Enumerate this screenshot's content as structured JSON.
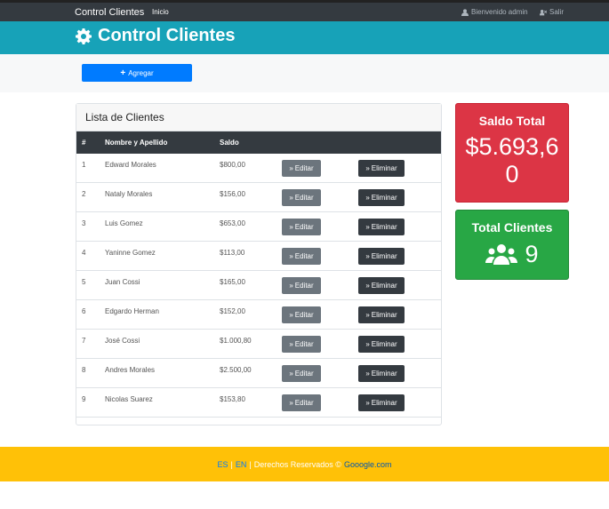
{
  "navbar": {
    "brand": "Control Clientes",
    "home": "Inicio",
    "welcome": "Bienvenido admin",
    "logout": "Salir"
  },
  "header": {
    "title": "Control Clientes"
  },
  "actions": {
    "add_label": "Agregar"
  },
  "clients": {
    "title": "Lista de Clientes",
    "columns": [
      "#",
      "Nombre y Apellido",
      "Saldo"
    ],
    "edit_label": "Editar",
    "delete_label": "Eliminar",
    "rows": [
      {
        "id": "1",
        "name": "Edward Morales",
        "balance": "$800,00"
      },
      {
        "id": "2",
        "name": "Nataly Morales",
        "balance": "$156,00"
      },
      {
        "id": "3",
        "name": "Luis Gomez",
        "balance": "$653,00"
      },
      {
        "id": "4",
        "name": "Yaninne Gomez",
        "balance": "$113,00"
      },
      {
        "id": "5",
        "name": "Juan Cossi",
        "balance": "$165,00"
      },
      {
        "id": "6",
        "name": "Edgardo Herman",
        "balance": "$152,00"
      },
      {
        "id": "7",
        "name": "José Cossi",
        "balance": "$1.000,80"
      },
      {
        "id": "8",
        "name": "Andres Morales",
        "balance": "$2.500,00"
      },
      {
        "id": "9",
        "name": "Nicolas Suarez",
        "balance": "$153,80"
      }
    ]
  },
  "stats": {
    "saldo_title": "Saldo Total",
    "saldo_value": "$5.693,60",
    "clients_title": "Total Clientes",
    "clients_value": "9"
  },
  "footer": {
    "lang_es": "ES",
    "sep1": "|",
    "lang_en": "EN",
    "sep2": "|",
    "rights": "Derechos Reservados ©",
    "link": "Gooogle.com"
  },
  "colors": {
    "navbar": "#343a40",
    "header": "#17a2b8",
    "primary": "#007bff",
    "danger": "#dc3545",
    "success": "#28a745",
    "footer": "#ffc107"
  }
}
